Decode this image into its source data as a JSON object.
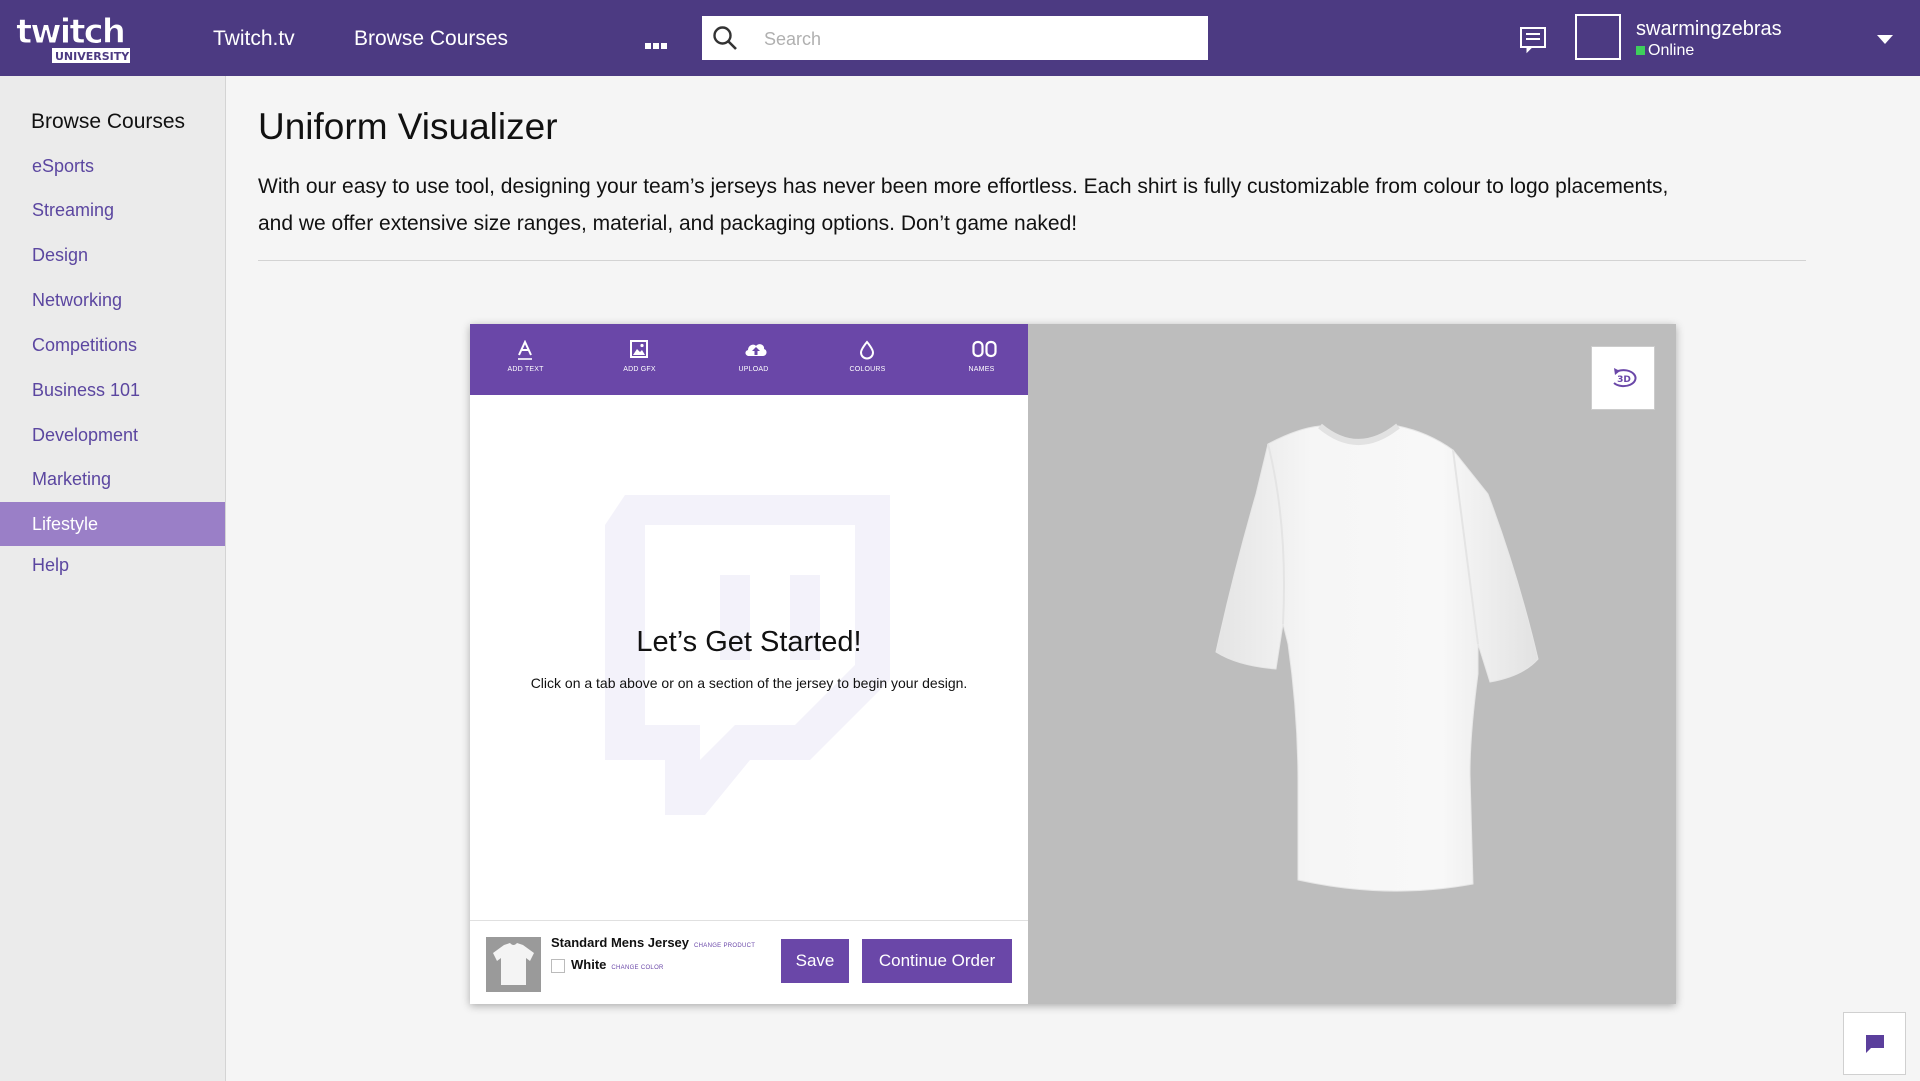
{
  "header": {
    "logo_text": "twitch UNIVERSITY",
    "nav": [
      "Twitch.tv",
      "Browse Courses"
    ],
    "search_placeholder": "Search",
    "user": {
      "name": "swarmingzebras",
      "status": "Online"
    }
  },
  "sidebar": {
    "title": "Browse Courses",
    "items": [
      {
        "label": "eSports"
      },
      {
        "label": "Streaming"
      },
      {
        "label": "Design"
      },
      {
        "label": "Networking"
      },
      {
        "label": "Competitions"
      },
      {
        "label": "Business 101"
      },
      {
        "label": "Development"
      },
      {
        "label": "Marketing"
      },
      {
        "label": "Lifestyle",
        "active": true
      },
      {
        "label": "Help"
      }
    ]
  },
  "main": {
    "title": "Uniform Visualizer",
    "intro": "With our easy to use tool, designing your team’s jerseys has never been more effortless. Each shirt is fully customizable from colour to logo placements, and we offer extensive size ranges, material, and packaging options. Don’t game naked!"
  },
  "visualizer": {
    "tabs": [
      {
        "label": "ADD TEXT",
        "icon": "text-icon"
      },
      {
        "label": "ADD GFX",
        "icon": "image-icon"
      },
      {
        "label": "UPLOAD",
        "icon": "cloud-upload-icon"
      },
      {
        "label": "COLOURS",
        "icon": "droplet-icon"
      },
      {
        "label": "NAMES",
        "icon": "numbers-icon"
      }
    ],
    "start_title": "Let’s Get Started!",
    "start_text": "Click on a tab above or on a section of the jersey to begin your design.",
    "product": {
      "name": "Standard Mens Jersey",
      "change_product": "CHANGE PRODUCT",
      "color": "White",
      "change_color": "CHANGE COLOR"
    },
    "save_label": "Save",
    "continue_label": "Continue Order",
    "view_toggle": "3D"
  },
  "colors": {
    "brand": "#4c3a82",
    "accent": "#6a47a8",
    "sidebar_active": "#9a7fc7",
    "online": "#3ecf5c"
  }
}
